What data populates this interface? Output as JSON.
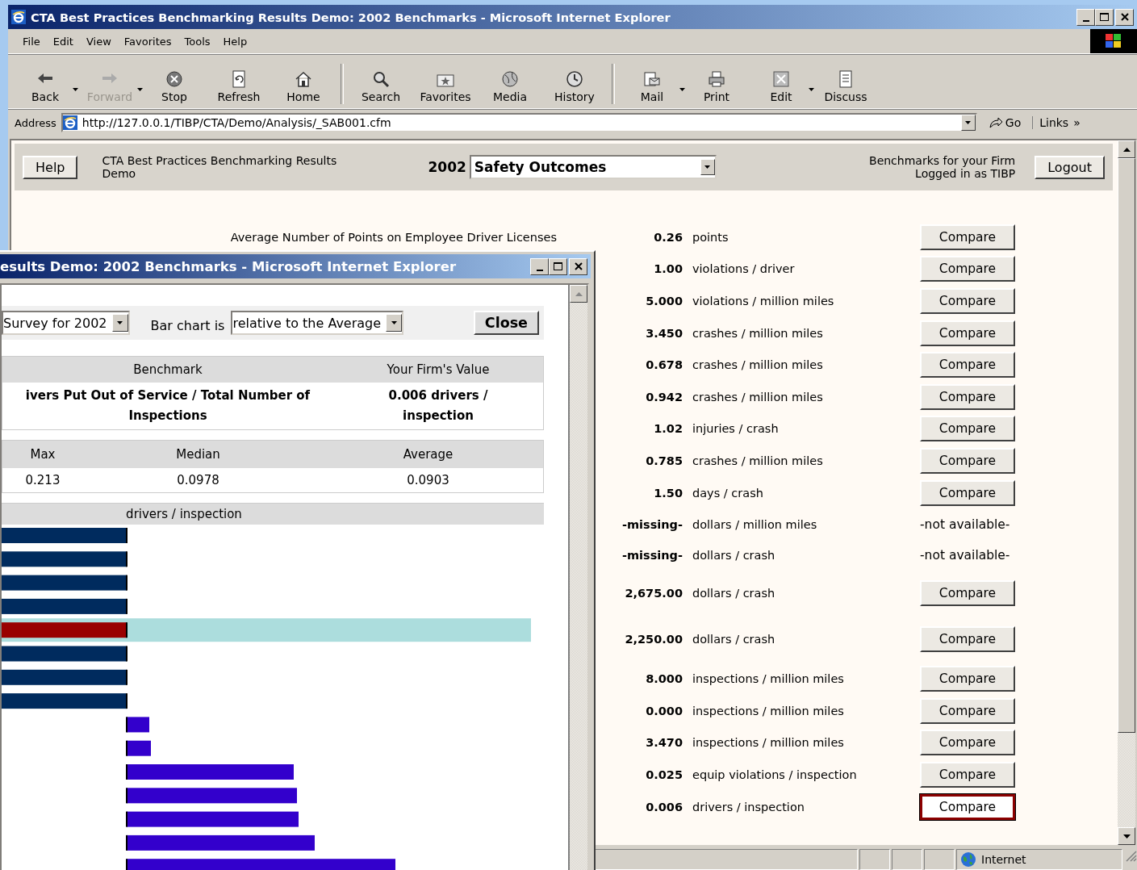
{
  "main_window": {
    "title": "CTA Best Practices Benchmarking Results Demo: 2002 Benchmarks - Microsoft Internet Explorer",
    "menu": [
      "File",
      "Edit",
      "View",
      "Favorites",
      "Tools",
      "Help"
    ],
    "toolbar": [
      {
        "label": "Back",
        "disabled": false,
        "dropdown": true
      },
      {
        "label": "Forward",
        "disabled": true,
        "dropdown": true
      },
      {
        "label": "Stop",
        "disabled": false,
        "dropdown": false
      },
      {
        "label": "Refresh",
        "disabled": false,
        "dropdown": false
      },
      {
        "label": "Home",
        "disabled": false,
        "dropdown": false
      },
      {
        "label": "Search",
        "disabled": false,
        "dropdown": false
      },
      {
        "label": "Favorites",
        "disabled": false,
        "dropdown": false
      },
      {
        "label": "Media",
        "disabled": false,
        "dropdown": false
      },
      {
        "label": "History",
        "disabled": false,
        "dropdown": false
      },
      {
        "label": "Mail",
        "disabled": false,
        "dropdown": true
      },
      {
        "label": "Print",
        "disabled": false,
        "dropdown": false
      },
      {
        "label": "Edit",
        "disabled": false,
        "dropdown": true
      },
      {
        "label": "Discuss",
        "disabled": false,
        "dropdown": false
      }
    ],
    "address": {
      "label": "Address",
      "value": "http://127.0.0.1/TIBP/CTA/Demo/Analysis/_SAB001.cfm",
      "go": "Go",
      "links": "Links",
      "more": "»"
    },
    "status_bar": {
      "zone": "Internet"
    }
  },
  "page_header": {
    "help": "Help",
    "title": "CTA Best Practices Benchmarking Results Demo",
    "year": "2002",
    "category": "Safety Outcomes",
    "firm_label": "Benchmarks for your Firm",
    "login": "Logged in as TIBP",
    "logout": "Logout"
  },
  "benchmarks": [
    {
      "label": "Average Number of Points on Employee Driver Licenses",
      "value": "0.26",
      "unit": "points",
      "action": {
        "kind": "button",
        "label": "Compare",
        "selected": false
      }
    },
    {
      "value": "1.00",
      "unit": "violations / driver",
      "action": {
        "kind": "button",
        "label": "Compare",
        "selected": false
      }
    },
    {
      "value": "5.000",
      "unit": "violations / million miles",
      "action": {
        "kind": "button",
        "label": "Compare",
        "selected": false
      }
    },
    {
      "value": "3.450",
      "unit": "crashes / million miles",
      "action": {
        "kind": "button",
        "label": "Compare",
        "selected": false
      }
    },
    {
      "value": "0.678",
      "unit": "crashes / million miles",
      "action": {
        "kind": "button",
        "label": "Compare",
        "selected": false
      }
    },
    {
      "value": "0.942",
      "unit": "crashes / million miles",
      "action": {
        "kind": "button",
        "label": "Compare",
        "selected": false
      }
    },
    {
      "value": "1.02",
      "unit": "injuries / crash",
      "action": {
        "kind": "button",
        "label": "Compare",
        "selected": false
      }
    },
    {
      "value": "0.785",
      "unit": "crashes / million miles",
      "action": {
        "kind": "button",
        "label": "Compare",
        "selected": false
      }
    },
    {
      "value": "1.50",
      "unit": "days / crash",
      "action": {
        "kind": "button",
        "label": "Compare",
        "selected": false
      }
    },
    {
      "value": "-missing-",
      "unit": "dollars / million miles",
      "action": {
        "kind": "text",
        "label": "-not available-"
      }
    },
    {
      "value": "-missing-",
      "unit": "dollars / crash",
      "action": {
        "kind": "text",
        "label": "-not available-"
      }
    },
    {
      "value": "2,675.00",
      "unit": "dollars / crash",
      "action": {
        "kind": "button",
        "label": "Compare",
        "selected": false
      }
    },
    {
      "value": "2,250.00",
      "unit": "dollars / crash",
      "action": {
        "kind": "button",
        "label": "Compare",
        "selected": false
      }
    },
    {
      "value": "8.000",
      "unit": "inspections / million miles",
      "action": {
        "kind": "button",
        "label": "Compare",
        "selected": false
      }
    },
    {
      "value": "0.000",
      "unit": "inspections / million miles",
      "action": {
        "kind": "button",
        "label": "Compare",
        "selected": false
      }
    },
    {
      "value": "3.470",
      "unit": "inspections / million miles",
      "action": {
        "kind": "button",
        "label": "Compare",
        "selected": false
      }
    },
    {
      "value": "0.025",
      "unit": "equip violations / inspection",
      "action": {
        "kind": "button",
        "label": "Compare",
        "selected": false
      }
    },
    {
      "value": "0.006",
      "unit": "drivers / inspection",
      "action": {
        "kind": "button",
        "label": "Compare",
        "selected": true
      }
    }
  ],
  "popup": {
    "title": "esults Demo: 2002 Benchmarks - Microsoft Internet Explorer",
    "survey": "Survey for 2002",
    "bar_chart_label": "Bar chart is",
    "bar_chart_mode": "relative to the Average",
    "close": "Close",
    "table": {
      "columns": [
        "Benchmark",
        "Your Firm's Value"
      ],
      "benchmark": "ivers Put Out of Service / Total Number of Inspections",
      "firm_value": "0.006 drivers / inspection"
    },
    "stats": {
      "columns": [
        "Max",
        "Median",
        "Average"
      ],
      "values": [
        "0.213",
        "0.0978",
        "0.0903"
      ]
    },
    "chart": {
      "title": "drivers / inspection",
      "bars": [
        {
          "kind": "below",
          "highlighted": false
        },
        {
          "kind": "below",
          "highlighted": false
        },
        {
          "kind": "below",
          "highlighted": false
        },
        {
          "kind": "below",
          "highlighted": false
        },
        {
          "kind": "below",
          "highlighted": true
        },
        {
          "kind": "below",
          "highlighted": false
        },
        {
          "kind": "below",
          "highlighted": false
        },
        {
          "kind": "below",
          "highlighted": false
        },
        {
          "kind": "above",
          "highlighted": false
        },
        {
          "kind": "above",
          "highlighted": false
        },
        {
          "kind": "above",
          "highlighted": false
        },
        {
          "kind": "above",
          "highlighted": false
        },
        {
          "kind": "above",
          "highlighted": false
        },
        {
          "kind": "above",
          "highlighted": false
        },
        {
          "kind": "above",
          "highlighted": false
        }
      ]
    }
  }
}
